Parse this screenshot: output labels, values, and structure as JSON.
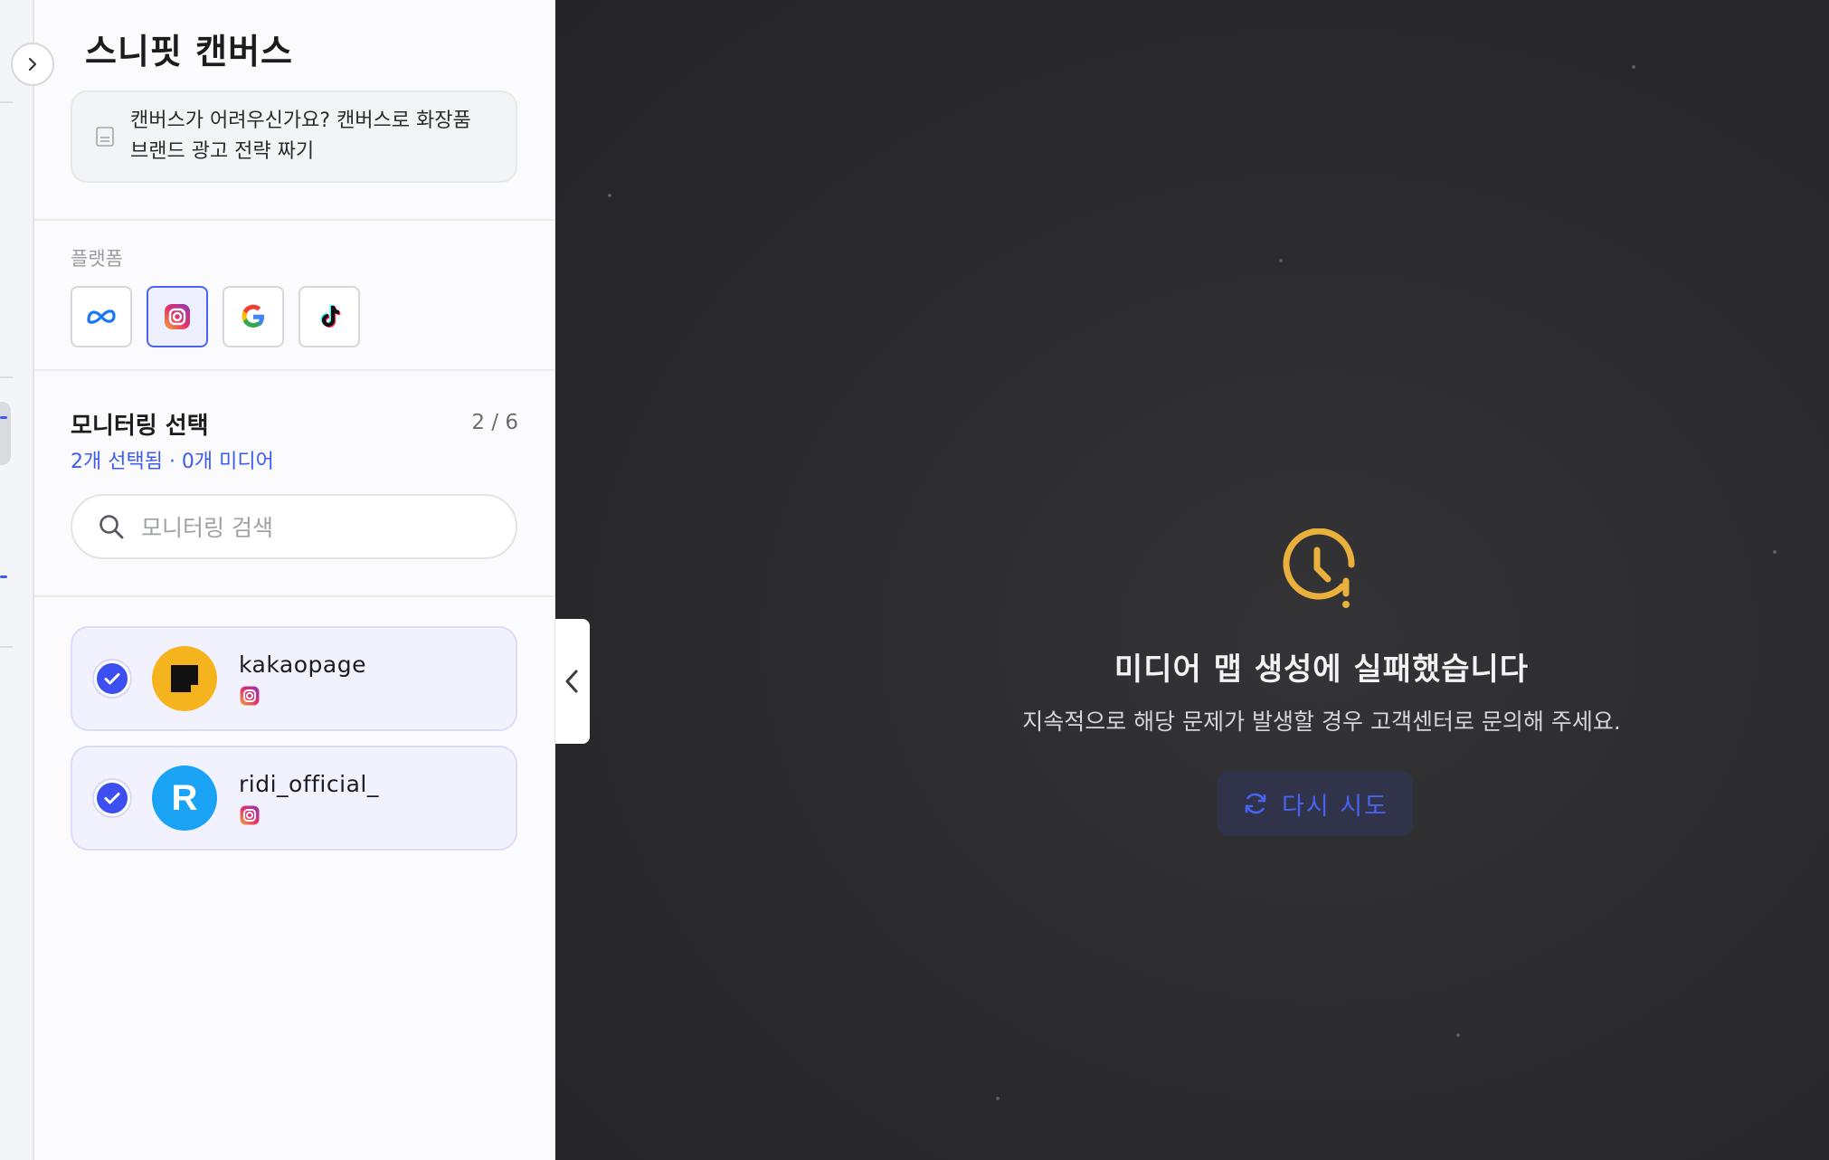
{
  "panel": {
    "title": "스니핏 캔버스",
    "guide": {
      "line1": "캔버스가 어려우신가요? 캔버스로 화장품",
      "line2": "브랜드 광고 전략 짜기",
      "icon": "document-icon"
    },
    "platform_label": "플랫폼",
    "platforms": [
      {
        "name": "meta",
        "icon": "meta-icon",
        "selected": false
      },
      {
        "name": "instagram",
        "icon": "instagram-icon",
        "selected": true
      },
      {
        "name": "google",
        "icon": "google-icon",
        "selected": false
      },
      {
        "name": "tiktok",
        "icon": "tiktok-icon",
        "selected": false
      }
    ],
    "monitoring": {
      "title": "모니터링 선택",
      "count": "2 / 6",
      "subtitle": "2개 선택됨 · 0개 미디어",
      "search_placeholder": "모니터링 검색"
    },
    "accounts": [
      {
        "name": "kakaopage",
        "avatar_color": "#f5b41d",
        "platform_icon": "instagram-icon",
        "checked": true
      },
      {
        "name": "ridi_official_",
        "avatar_color": "#1aa3f4",
        "avatar_letter": "R",
        "platform_icon": "instagram-icon",
        "checked": true
      }
    ]
  },
  "main": {
    "error_title": "미디어 맵 생성에 실패했습니다",
    "error_desc": "지속적으로 해당 문제가 발생할 경우 고객센터로 문의해 주세요.",
    "retry_label": "다시 시도",
    "error_icon": "clock-warning-icon",
    "accent": "#eab03c",
    "retry_color": "#4a62f2"
  }
}
